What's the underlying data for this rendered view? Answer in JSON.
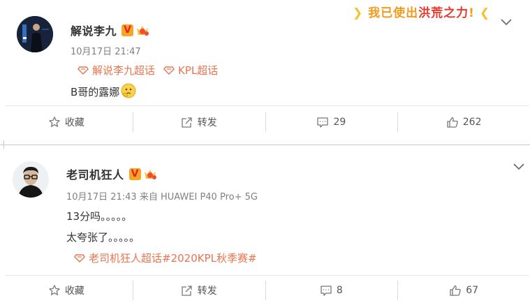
{
  "posts": [
    {
      "author": "解说李九",
      "verified_badge": "V",
      "meta": "10月17日 21:47",
      "topics": [
        "解说李九超话",
        "KPL超话"
      ],
      "text_lines": [
        "B哥的露娜"
      ],
      "emoji": "thinking-face",
      "actions": {
        "favorite": "收藏",
        "repost": "转发",
        "comments": "29",
        "likes": "262"
      },
      "banner": {
        "lead": "我已使出",
        "highlight": "洪荒之力",
        "tail": "!"
      }
    },
    {
      "author": "老司机狂人",
      "verified_badge": "V",
      "meta": "10月17日 21:43 来自 HUAWEI P40 Pro+ 5G",
      "topics": [
        "老司机狂人超话#2020KPL秋季赛#"
      ],
      "text_lines": [
        "13分吗。。。。。",
        "太夸张了。。。。。"
      ],
      "actions": {
        "favorite": "收藏",
        "repost": "转发",
        "comments": "8",
        "likes": "67"
      }
    }
  ],
  "colors": {
    "topic": "#eb7350",
    "name": "#333333",
    "meta": "#808080",
    "badge_bg": "#f5a623",
    "badge_v": "#e8232d"
  },
  "icons": [
    "star-outline-icon",
    "share-arrow-icon",
    "comment-icon",
    "thumbs-up-icon",
    "chevron-down-icon",
    "topic-diamond-icon",
    "vip-crown-icon"
  ]
}
